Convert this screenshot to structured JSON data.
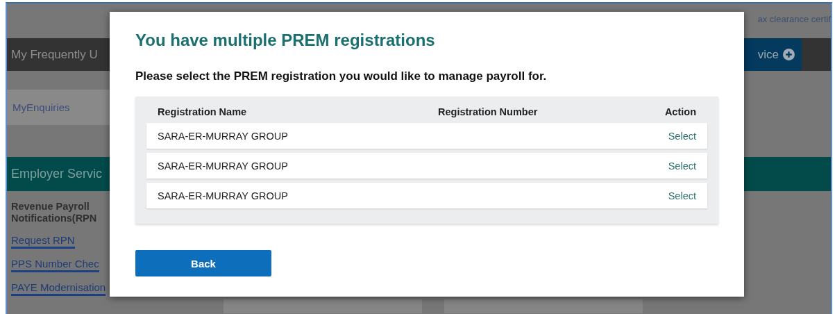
{
  "background": {
    "top_link": "ax clearance certif",
    "frequent_header": "My Frequently U",
    "service_tab": "vice",
    "my_enquiries": "MyEnquiries",
    "employer_header": "Employer Servic",
    "rpn_heading": "Revenue Payroll Notifications(RPN",
    "links": [
      "Request RPN",
      "PPS Number Chec",
      "PAYE Modernisation"
    ]
  },
  "dialog": {
    "title": "You have multiple PREM registrations",
    "prompt": "Please select the PREM registration you would like to manage payroll for.",
    "table": {
      "columns": [
        "Registration Name",
        "Registration Number",
        "Action"
      ],
      "rows": [
        {
          "name": "SARA-ER-MURRAY GROUP",
          "action": "Select"
        },
        {
          "name": "SARA-ER-MURRAY GROUP",
          "action": "Select"
        },
        {
          "name": "SARA-ER-MURRAY GROUP",
          "action": "Select"
        }
      ]
    },
    "buttons": [
      "Back"
    ]
  }
}
